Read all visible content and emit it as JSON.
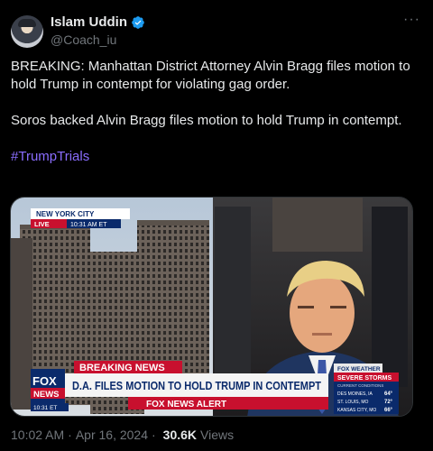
{
  "author": {
    "display_name": "Islam Uddin",
    "handle": "@Coach_iu",
    "verified": true,
    "more_icon": "ellipsis-icon"
  },
  "tweet": {
    "paragraph1": "BREAKING: Manhattan District Attorney Alvin Bragg files motion to hold Trump in contempt for violating gag order.",
    "paragraph2": "Soros backed Alvin Bragg files motion to hold Trump in contempt.",
    "hashtag": "#TrumpTrials"
  },
  "media": {
    "location_label": "NEW YORK CITY",
    "live_label": "LIVE",
    "live_time": "10:31 AM ET",
    "breaking_label": "BREAKING NEWS",
    "headline": "D.A. FILES MOTION TO HOLD TRUMP IN CONTEMPT",
    "network_top": "FOX",
    "network_bottom": "NEWS",
    "bug_time": "10:31 ET",
    "alert_label": "FOX NEWS ALERT",
    "weather_brand": "FOX WEATHER",
    "weather_title": "SEVERE STORMS",
    "weather_sub": "CURRENT CONDITIONS",
    "weather_rows": [
      {
        "city": "DES MOINES, IA",
        "temp": "64°"
      },
      {
        "city": "ST. LOUIS, MO",
        "temp": "72°"
      },
      {
        "city": "KANSAS CITY, MO",
        "temp": "66°"
      }
    ],
    "colors": {
      "fox_red": "#c8102e",
      "fox_blue": "#0a2a6b"
    }
  },
  "meta": {
    "time": "10:02 AM",
    "separator": "·",
    "date": "Apr 16, 2024",
    "views_count": "30.6K",
    "views_label": "Views"
  }
}
